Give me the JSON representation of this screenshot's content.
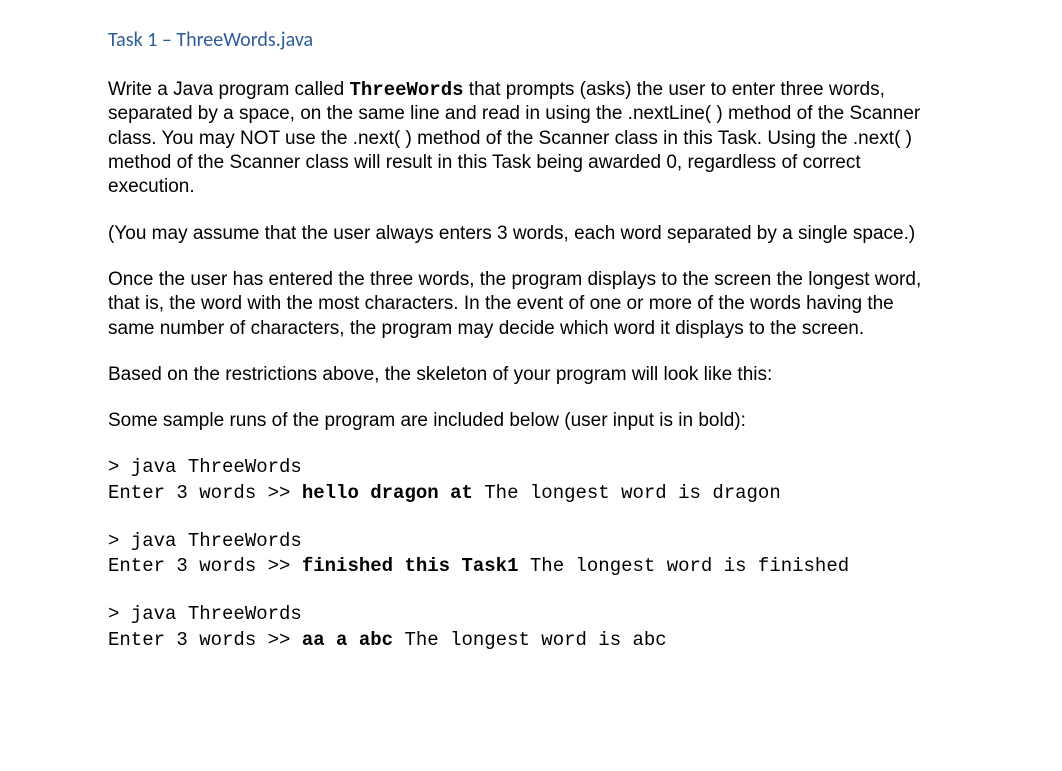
{
  "heading": "Task 1 – ThreeWords.java",
  "para1_a": "Write a Java program called ",
  "para1_code": "ThreeWords",
  "para1_b": " that prompts (asks) the user to enter three words, separated by a space, on the same line and read in using the .nextLine( ) method of the Scanner class. You may NOT use the .next( ) method of the Scanner class in this Task. Using the .next( ) method of the Scanner class will result in this Task being awarded 0, regardless of correct execution.",
  "para2": "(You may assume that the user always enters 3 words, each word separated by a single space.)",
  "para3": "Once the user has entered the three words, the program displays to the screen the longest word, that is, the word with the most characters. In the event of one or more of the words having the same number of characters, the program may decide which word it displays to the screen.",
  "para4": "Based on the restrictions above, the skeleton of your program will look like this:",
  "para5": "Some sample runs of the program are included below (user input is in bold):",
  "samples": [
    {
      "cmd": "> java ThreeWords",
      "prompt": "Enter 3 words >> ",
      "input": "hello dragon at",
      "output": " The longest word is dragon"
    },
    {
      "cmd": "> java ThreeWords",
      "prompt": "Enter 3 words >> ",
      "input": "finished this Task1",
      "output": " The longest word is finished"
    },
    {
      "cmd": "> java ThreeWords",
      "prompt": "Enter 3 words >> ",
      "input": "aa a abc",
      "output": " The longest word is abc"
    }
  ]
}
